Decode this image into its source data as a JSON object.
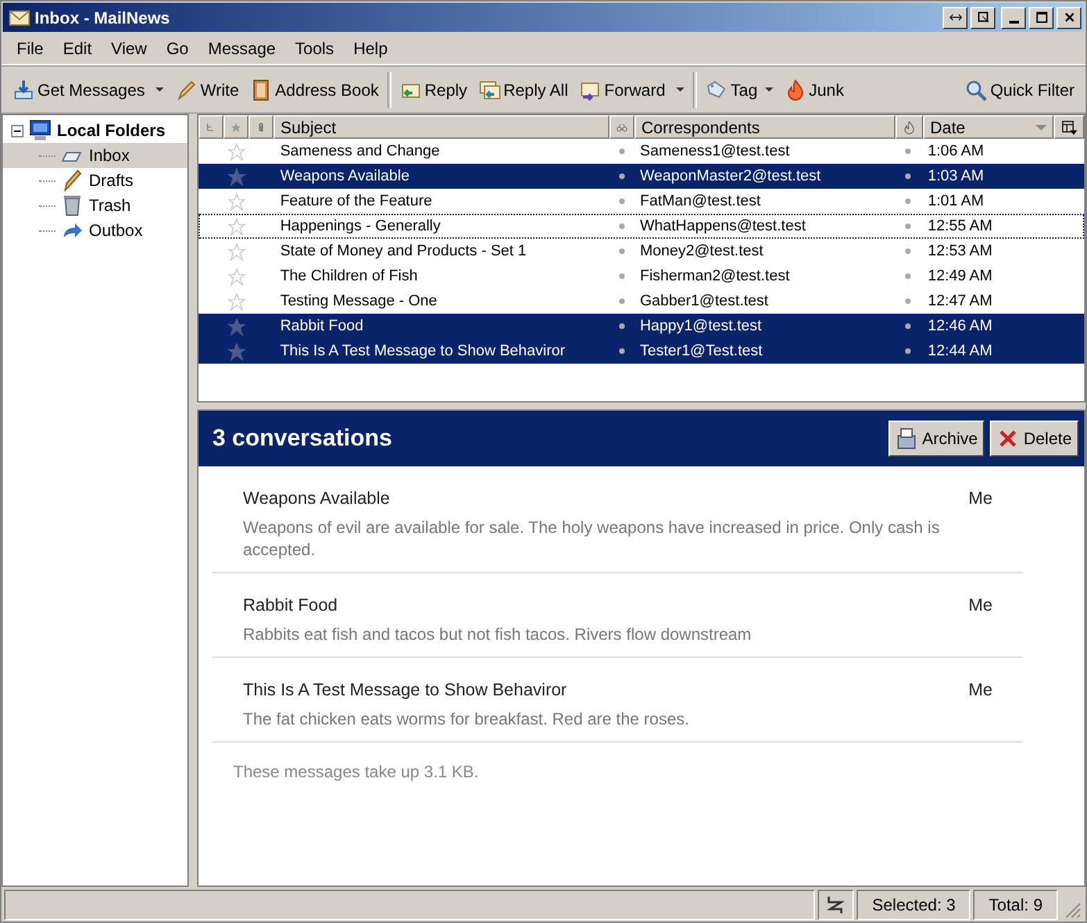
{
  "window": {
    "title": "Inbox - MailNews"
  },
  "menu": [
    {
      "label": "File"
    },
    {
      "label": "Edit"
    },
    {
      "label": "View"
    },
    {
      "label": "Go"
    },
    {
      "label": "Message"
    },
    {
      "label": "Tools"
    },
    {
      "label": "Help"
    }
  ],
  "toolbar": [
    {
      "kind": "button",
      "label": "Get Messages",
      "dropdown": true
    },
    {
      "kind": "button",
      "label": "Write"
    },
    {
      "kind": "button",
      "label": "Address Book"
    },
    {
      "kind": "separator"
    },
    {
      "kind": "button",
      "label": "Reply"
    },
    {
      "kind": "button",
      "label": "Reply All"
    },
    {
      "kind": "button",
      "label": "Forward",
      "dropdown": true
    },
    {
      "kind": "separator"
    },
    {
      "kind": "button",
      "label": "Tag",
      "menu": true
    },
    {
      "kind": "button",
      "label": "Junk"
    },
    {
      "kind": "spacer"
    },
    {
      "kind": "button",
      "label": "Quick Filter"
    }
  ],
  "folders": [
    {
      "label": "Local Folders",
      "expanded": true,
      "selected": false,
      "children": [
        {
          "label": "Inbox",
          "selected": true
        },
        {
          "label": "Drafts",
          "selected": false
        },
        {
          "label": "Trash",
          "selected": false
        },
        {
          "label": "Outbox",
          "selected": false
        }
      ]
    }
  ],
  "table": {
    "columns": [
      {
        "kind": "thread"
      },
      {
        "kind": "star"
      },
      {
        "kind": "attach"
      },
      {
        "kind": "text",
        "label": "Subject"
      },
      {
        "kind": "read"
      },
      {
        "kind": "text",
        "label": "Correspondents"
      },
      {
        "kind": "junk"
      },
      {
        "kind": "text",
        "label": "Date",
        "sorted": true
      },
      {
        "kind": "picker"
      }
    ],
    "rows": [
      {
        "subject": "Sameness and Change",
        "correspondent": "Sameness1@test.test",
        "date": "1:06 AM",
        "selected": false,
        "focused": false
      },
      {
        "subject": "Weapons Available",
        "correspondent": "WeaponMaster2@test.test",
        "date": "1:03 AM",
        "selected": true,
        "focused": false
      },
      {
        "subject": "Feature of the Feature",
        "correspondent": "FatMan@test.test",
        "date": "1:01 AM",
        "selected": false,
        "focused": false
      },
      {
        "subject": "Happenings - Generally",
        "correspondent": "WhatHappens@test.test",
        "date": "12:55 AM",
        "selected": false,
        "focused": true
      },
      {
        "subject": "State of Money and Products - Set 1",
        "correspondent": "Money2@test.test",
        "date": "12:53 AM",
        "selected": false,
        "focused": false
      },
      {
        "subject": "The Children of Fish",
        "correspondent": "Fisherman2@test.test",
        "date": "12:49 AM",
        "selected": false,
        "focused": false
      },
      {
        "subject": "Testing Message - One",
        "correspondent": "Gabber1@test.test",
        "date": "12:47 AM",
        "selected": false,
        "focused": false
      },
      {
        "subject": "Rabbit Food",
        "correspondent": "Happy1@test.test",
        "date": "12:46 AM",
        "selected": true,
        "focused": false
      },
      {
        "subject": "This Is A Test Message to Show Behaviror",
        "correspondent": "Tester1@Test.test",
        "date": "12:44 AM",
        "selected": true,
        "focused": false
      }
    ]
  },
  "summary": {
    "title": "3 conversations",
    "buttons": [
      {
        "label": "Archive"
      },
      {
        "label": "Delete"
      }
    ],
    "conversations": [
      {
        "subject": "Weapons Available",
        "sender": "Me",
        "snippet": "Weapons of evil are available for sale. The holy weapons have increased in price. Only cash is accepted."
      },
      {
        "subject": "Rabbit Food",
        "sender": "Me",
        "snippet": "Rabbits eat fish and tacos but not fish tacos. Rivers flow downstream"
      },
      {
        "subject": "This Is A Test Message to Show Behaviror",
        "sender": "Me",
        "snippet": "The fat chicken eats worms for breakfast. Red are the roses."
      }
    ],
    "footer": "These messages take up 3.1 KB."
  },
  "status_bar": {
    "selected": "Selected: 3",
    "total": "Total: 9"
  }
}
